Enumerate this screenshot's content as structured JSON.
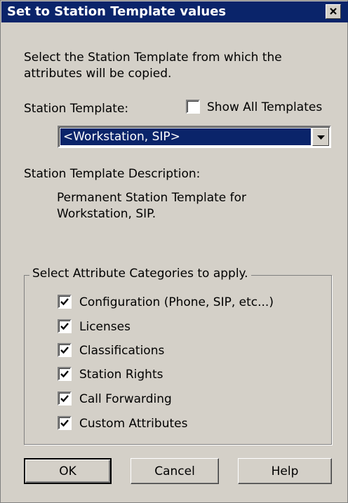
{
  "window": {
    "title": "Set to Station Template values"
  },
  "instructions": "Select the Station Template from which the attributes will be copied.",
  "station_template": {
    "label": "Station Template:",
    "show_all_label": "Show All Templates",
    "show_all_checked": false,
    "selected_value": "<Workstation, SIP>"
  },
  "description": {
    "label": "Station Template Description:",
    "text_line1": "Permanent Station Template for",
    "text_line2": "Workstation, SIP."
  },
  "categories": {
    "group_label": "Select Attribute Categories to apply.",
    "items": [
      {
        "label": "Configuration (Phone, SIP, etc...)",
        "checked": true
      },
      {
        "label": "Licenses",
        "checked": true
      },
      {
        "label": "Classifications",
        "checked": true
      },
      {
        "label": "Station Rights",
        "checked": true
      },
      {
        "label": "Call Forwarding",
        "checked": true
      },
      {
        "label": "Custom Attributes",
        "checked": true
      }
    ]
  },
  "buttons": {
    "ok": "OK",
    "cancel": "Cancel",
    "help": "Help"
  },
  "colors": {
    "titlebar": "#0a246a",
    "face": "#d4d0c8",
    "selection": "#0a246a"
  },
  "icons": {
    "close": "close-icon",
    "dropdown": "chevron-down-icon",
    "check": "checkmark-icon"
  }
}
